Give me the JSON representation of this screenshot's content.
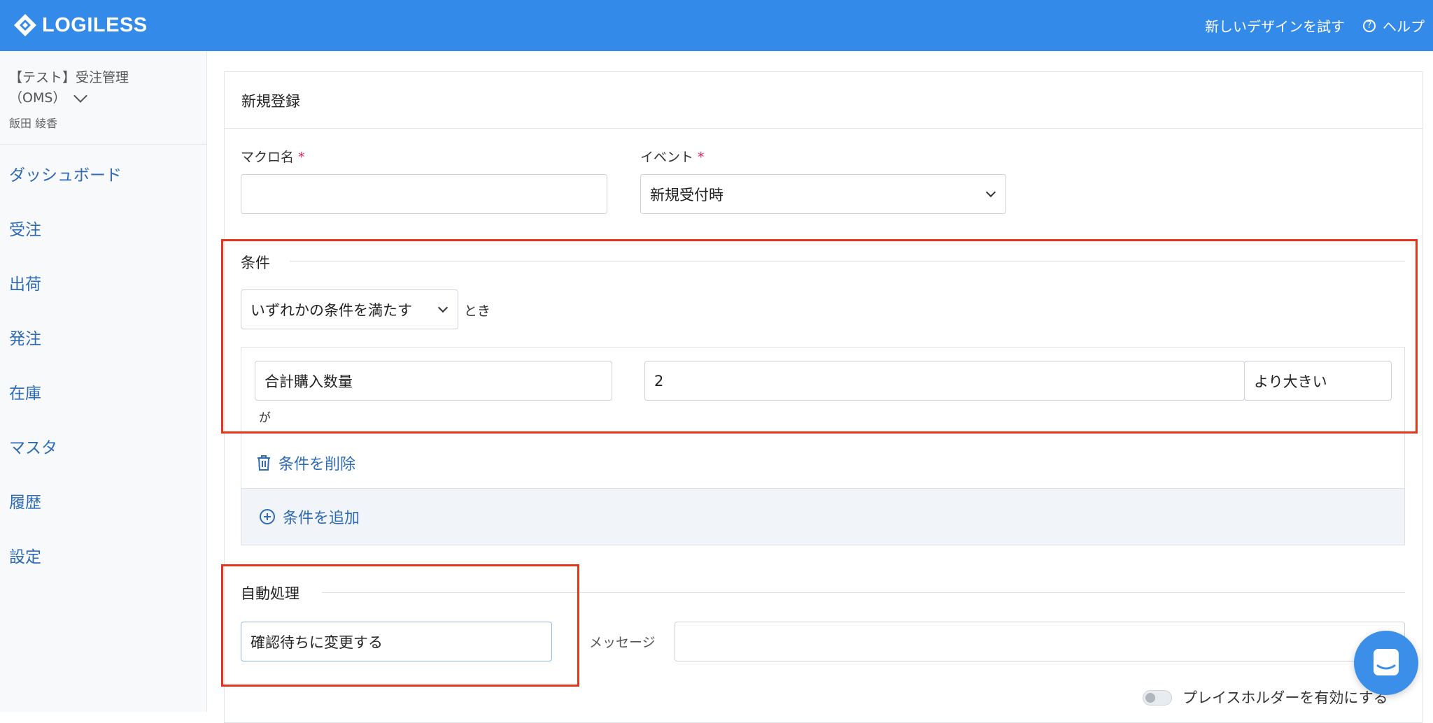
{
  "header": {
    "logo_text": "LOGILESS",
    "try_new_design": "新しいデザインを試す",
    "help": "ヘルプ"
  },
  "sidebar": {
    "tenant_line1": "【テスト】受注管理",
    "tenant_line2": "（OMS）",
    "user": "飯田 綾香",
    "items": [
      {
        "label": "ダッシュボード"
      },
      {
        "label": "受注"
      },
      {
        "label": "出荷"
      },
      {
        "label": "発注"
      },
      {
        "label": "在庫"
      },
      {
        "label": "マスタ"
      },
      {
        "label": "履歴"
      },
      {
        "label": "設定"
      }
    ]
  },
  "form": {
    "title": "新規登録",
    "macro_name_label": "マクロ名",
    "macro_name_value": "",
    "required_mark": "*",
    "event_label": "イベント",
    "event_value": "新規受付時"
  },
  "conditions": {
    "title": "条件",
    "match_mode": "いずれかの条件を満たす",
    "match_suffix": "とき",
    "rows": [
      {
        "field": "合計購入数量",
        "value": "2",
        "operator": "より大きい",
        "suffix": "が"
      }
    ],
    "delete_label": "条件を削除",
    "add_label": "条件を追加"
  },
  "auto_process": {
    "title": "自動処理",
    "action_value": "確認待ちに変更する",
    "message_label": "メッセージ",
    "message_value": "",
    "placeholder_toggle_label": "プレイスホルダーを有効にする",
    "placeholder_toggle_on": false
  },
  "colors": {
    "topbar": "#338ae8",
    "link": "#2f6bb5",
    "highlight": "#e3341c"
  }
}
